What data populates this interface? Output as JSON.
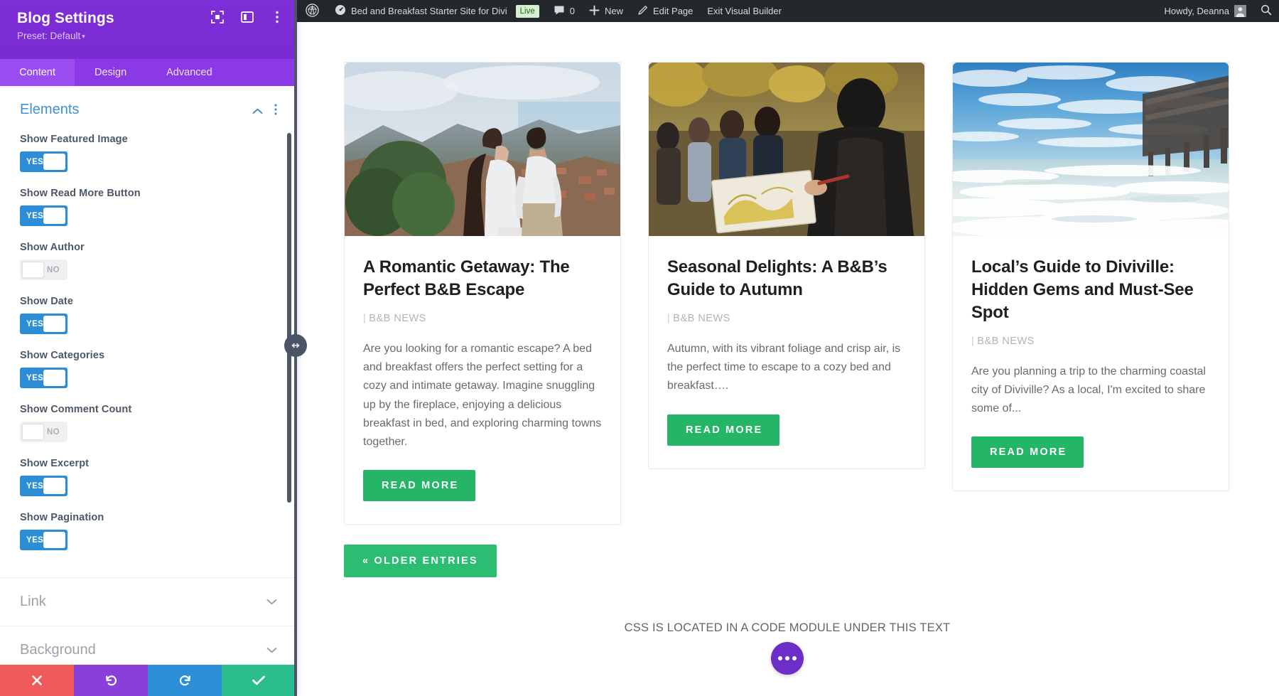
{
  "panel": {
    "title": "Blog Settings",
    "preset": "Preset: Default",
    "preset_caret": "▾",
    "header_icons": [
      "focus-frame-icon",
      "layout-panel-icon",
      "more-vertical-icon"
    ],
    "tabs": [
      {
        "label": "Content",
        "active": true
      },
      {
        "label": "Design",
        "active": false
      },
      {
        "label": "Advanced",
        "active": false
      }
    ],
    "section": {
      "title": "Elements",
      "collapse_icon": "chevron-up-icon",
      "more_icon": "more-vertical-icon"
    },
    "fields": [
      {
        "label": "Show Featured Image",
        "value": "YES",
        "on": true
      },
      {
        "label": "Show Read More Button",
        "value": "YES",
        "on": true
      },
      {
        "label": "Show Author",
        "value": "NO",
        "on": false
      },
      {
        "label": "Show Date",
        "value": "YES",
        "on": true
      },
      {
        "label": "Show Categories",
        "value": "YES",
        "on": true
      },
      {
        "label": "Show Comment Count",
        "value": "NO",
        "on": false
      },
      {
        "label": "Show Excerpt",
        "value": "YES",
        "on": true
      },
      {
        "label": "Show Pagination",
        "value": "YES",
        "on": true
      }
    ],
    "collapsed_sections": [
      {
        "title": "Link"
      },
      {
        "title": "Background"
      }
    ],
    "footer_buttons": [
      {
        "name": "cancel-button",
        "icon": "close-icon",
        "color": "#f05a5a"
      },
      {
        "name": "undo-button",
        "icon": "undo-icon",
        "color": "#8b3fd9"
      },
      {
        "name": "redo-button",
        "icon": "redo-icon",
        "color": "#2c8ed6"
      },
      {
        "name": "save-button",
        "icon": "check-icon",
        "color": "#2bbd8c"
      }
    ],
    "colors": {
      "header": "#7b2fd4",
      "tabbar": "#8b39e6",
      "tab_active": "#9a4cf0",
      "toggle_on": "#2c8ed6",
      "section_title": "#3f8fd6"
    }
  },
  "adminbar": {
    "wp_logo": "wordpress-icon",
    "dashboard_icon": "dashboard-icon",
    "site_name": "Bed and Breakfast Starter Site for Divi",
    "live_badge": "Live",
    "comment_icon": "comment-icon",
    "comment_count": "0",
    "new_icon": "plus-icon",
    "new_label": "New",
    "edit_icon": "pencil-icon",
    "edit_label": "Edit Page",
    "exit_label": "Exit Visual Builder",
    "howdy": "Howdy, Deanna",
    "avatar": "avatar-icon",
    "search_icon": "search-icon"
  },
  "main": {
    "cards": [
      {
        "image_alt": "couple-embracing-mountain-overlook",
        "title": "A Romantic Getaway: The Perfect B&B Escape",
        "meta_bar": "|",
        "meta": "B&B NEWS",
        "excerpt": "Are you looking for a romantic escape? A bed and breakfast offers the perfect setting for a cozy and intimate getaway. Imagine snuggling up by the fireplace, enjoying a delicious breakfast in bed, and exploring charming towns together.",
        "button": "Read More"
      },
      {
        "image_alt": "person-painting-outdoors-autumn",
        "title": "Seasonal Delights: A B&B’s Guide to Autumn",
        "meta_bar": "|",
        "meta": "B&B NEWS",
        "excerpt": "Autumn, with its vibrant foliage and crisp air, is the perfect time to escape to a cozy bed and breakfast….",
        "button": "Read More"
      },
      {
        "image_alt": "ocean-pier-beach-blue-sky",
        "title": "Local’s Guide to Diviville: Hidden Gems and Must-See Spot",
        "meta_bar": "|",
        "meta": "B&B NEWS",
        "excerpt": "Are you planning a trip to the charming coastal city of Diviville? As a local, I'm excited to share some of...",
        "button": "Read More"
      }
    ],
    "pagination_label": "« Older Entries",
    "css_note": "CSS IS LOCATED IN A CODE MODULE UNDER THIS TEXT",
    "fab": "more-options-fab"
  }
}
